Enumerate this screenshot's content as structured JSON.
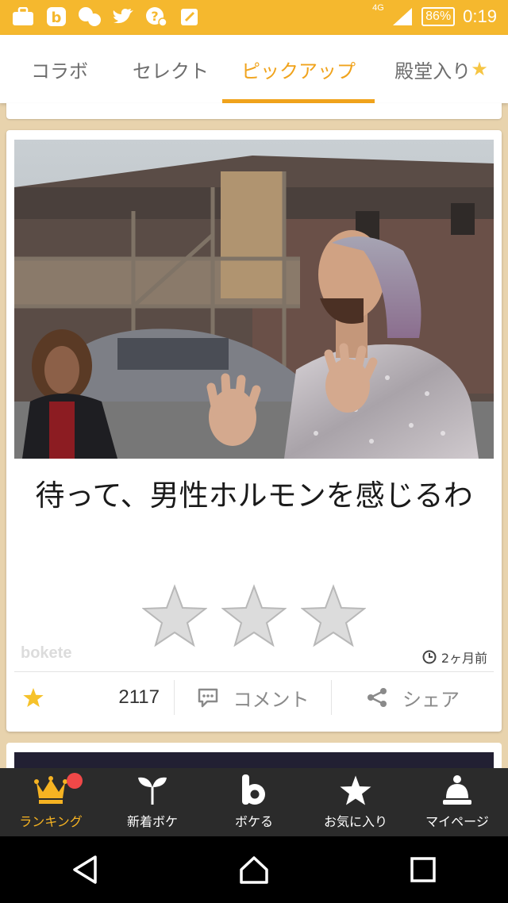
{
  "status_bar": {
    "network": "4G",
    "battery": "86%",
    "time": "0:19",
    "colors": {
      "background": "#f5b82e"
    }
  },
  "tabs": [
    {
      "label": "コラボ",
      "active": false
    },
    {
      "label": "セレクト",
      "active": false
    },
    {
      "label": "ピックアップ",
      "active": true
    },
    {
      "label": "殿堂入り",
      "active": false,
      "suffix": "★"
    }
  ],
  "post": {
    "caption": "待って、男性ホルモンを感じるわ",
    "rating_stars": 3,
    "watermark": "bokete",
    "time_ago": "2ヶ月前",
    "favorite_count": "2117",
    "comment_label": "コメント",
    "share_label": "シェア"
  },
  "bottom_nav": [
    {
      "label": "ランキング",
      "icon": "crown-icon",
      "active": true,
      "badge": true
    },
    {
      "label": "新着ボケ",
      "icon": "sprout-icon",
      "active": false
    },
    {
      "label": "ボケる",
      "icon": "bokete-b-icon",
      "active": false
    },
    {
      "label": "お気に入り",
      "icon": "star-icon",
      "active": false
    },
    {
      "label": "マイページ",
      "icon": "bell-icon",
      "active": false
    }
  ],
  "colors": {
    "accent": "#f0a31c",
    "background": "#e8d3ad",
    "nav_background": "#2b2b2b",
    "badge": "#f04848"
  }
}
